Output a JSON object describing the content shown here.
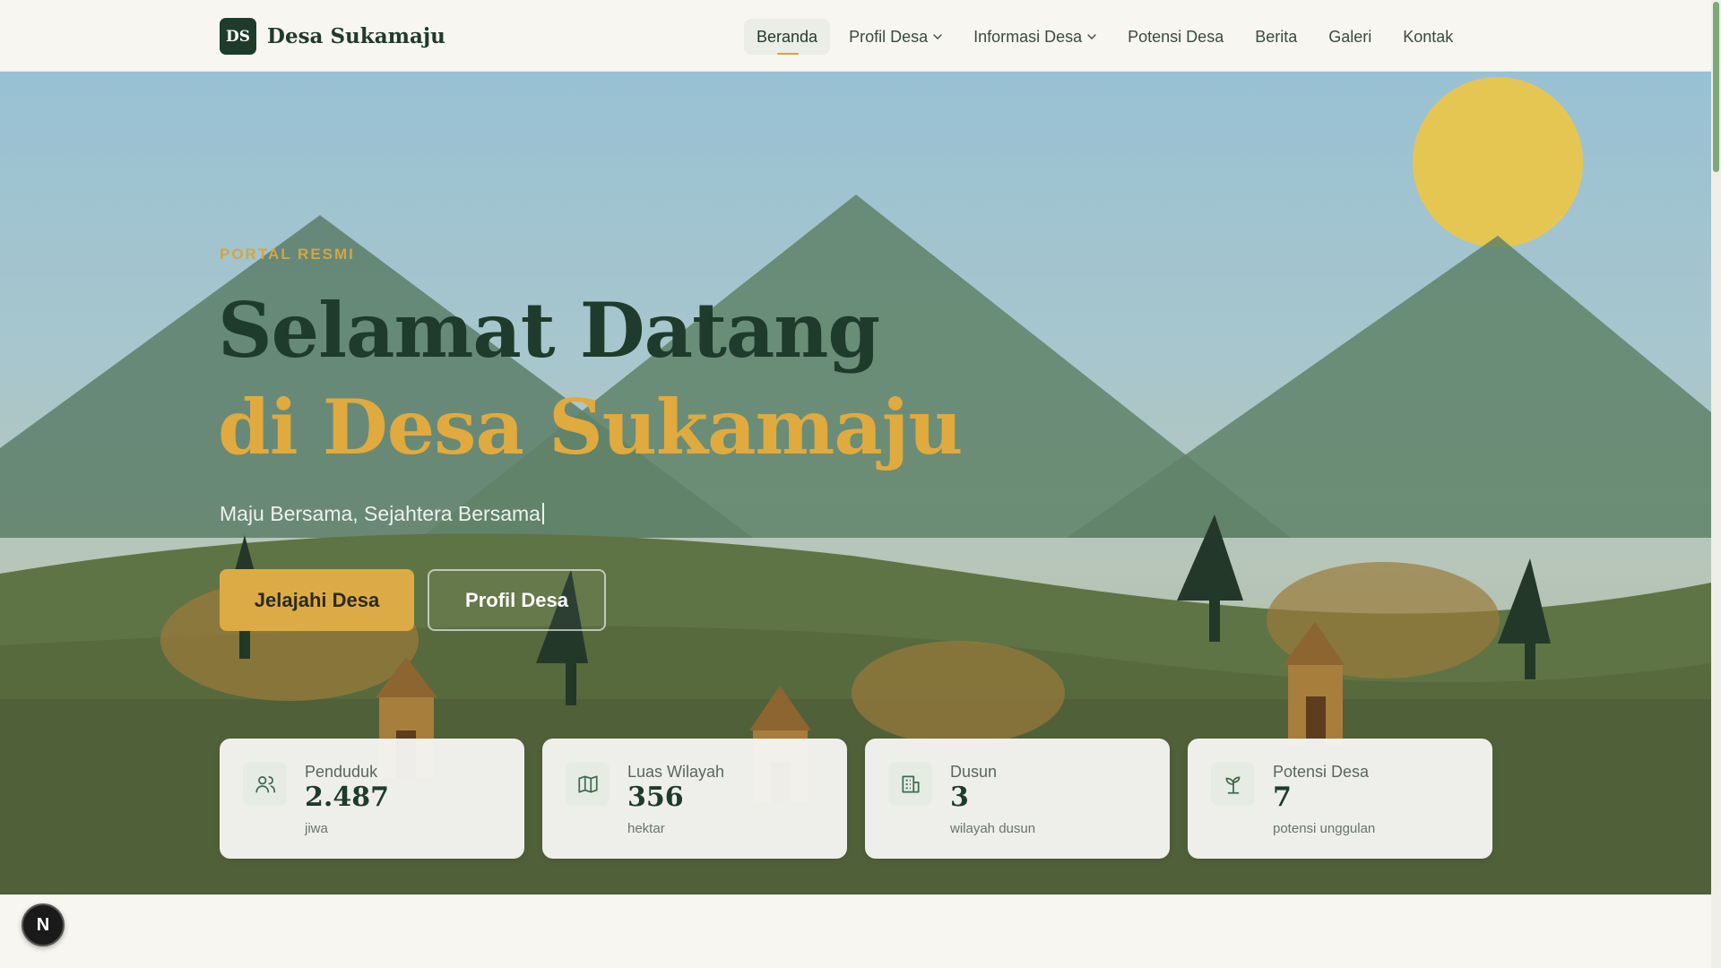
{
  "brand": {
    "logo_text": "DS",
    "name": "Desa Sukamaju"
  },
  "nav": {
    "items": [
      {
        "label": "Beranda",
        "active": true,
        "dropdown": false
      },
      {
        "label": "Profil Desa",
        "active": false,
        "dropdown": true
      },
      {
        "label": "Informasi Desa",
        "active": false,
        "dropdown": true
      },
      {
        "label": "Potensi Desa",
        "active": false,
        "dropdown": false
      },
      {
        "label": "Berita",
        "active": false,
        "dropdown": false
      },
      {
        "label": "Galeri",
        "active": false,
        "dropdown": false
      },
      {
        "label": "Kontak",
        "active": false,
        "dropdown": false
      }
    ]
  },
  "hero": {
    "eyebrow": "PORTAL RESMI",
    "title_line1": "Selamat Datang",
    "title_line2": "di Desa Sukamaju",
    "tagline": "Maju Bersama, Sejahtera Bersama",
    "primary_button": "Jelajahi Desa",
    "secondary_button": "Profil Desa"
  },
  "stats": [
    {
      "icon": "users-icon",
      "label": "Penduduk",
      "value": "2.487",
      "unit": "jiwa"
    },
    {
      "icon": "map-icon",
      "label": "Luas Wilayah",
      "value": "356",
      "unit": "hektar"
    },
    {
      "icon": "building-icon",
      "label": "Dusun",
      "value": "3",
      "unit": "wilayah dusun"
    },
    {
      "icon": "sprout-icon",
      "label": "Potensi Desa",
      "value": "7",
      "unit": "potensi unggulan"
    }
  ],
  "badge": {
    "text": "N"
  },
  "colors": {
    "primary": "#1e3b2c",
    "accent": "#e0aa3e",
    "background": "#f8f6f0"
  }
}
